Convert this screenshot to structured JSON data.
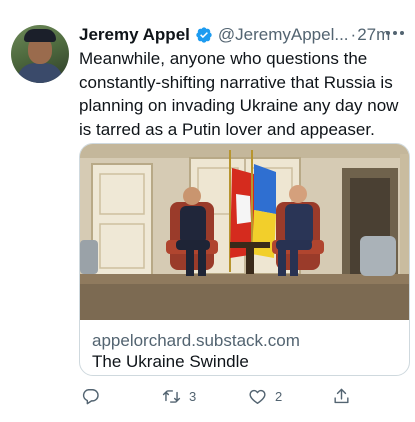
{
  "author": {
    "name": "Jeremy Appel",
    "handle": "@JeremyAppel...",
    "separator": "·",
    "time": "27m"
  },
  "tweet": {
    "text": "Meanwhile, anyone who questions the constantly-shifting narrative that Russia is planning on invading Ukraine any day now is tarred as a Putin lover and appeaser."
  },
  "card": {
    "domain": "appelorchard.substack.com",
    "title": "The Ukraine Swindle"
  },
  "actions": {
    "reply_count": "",
    "retweet_count": "3",
    "like_count": "2"
  },
  "icons": {
    "verified": "verified-badge-icon",
    "more": "more-options-icon",
    "reply": "reply-icon",
    "retweet": "retweet-icon",
    "like": "heart-icon",
    "share": "share-icon"
  },
  "colors": {
    "verified": "#1d9bf0",
    "secondary_text": "#536471",
    "card_border": "#cfd9de"
  }
}
